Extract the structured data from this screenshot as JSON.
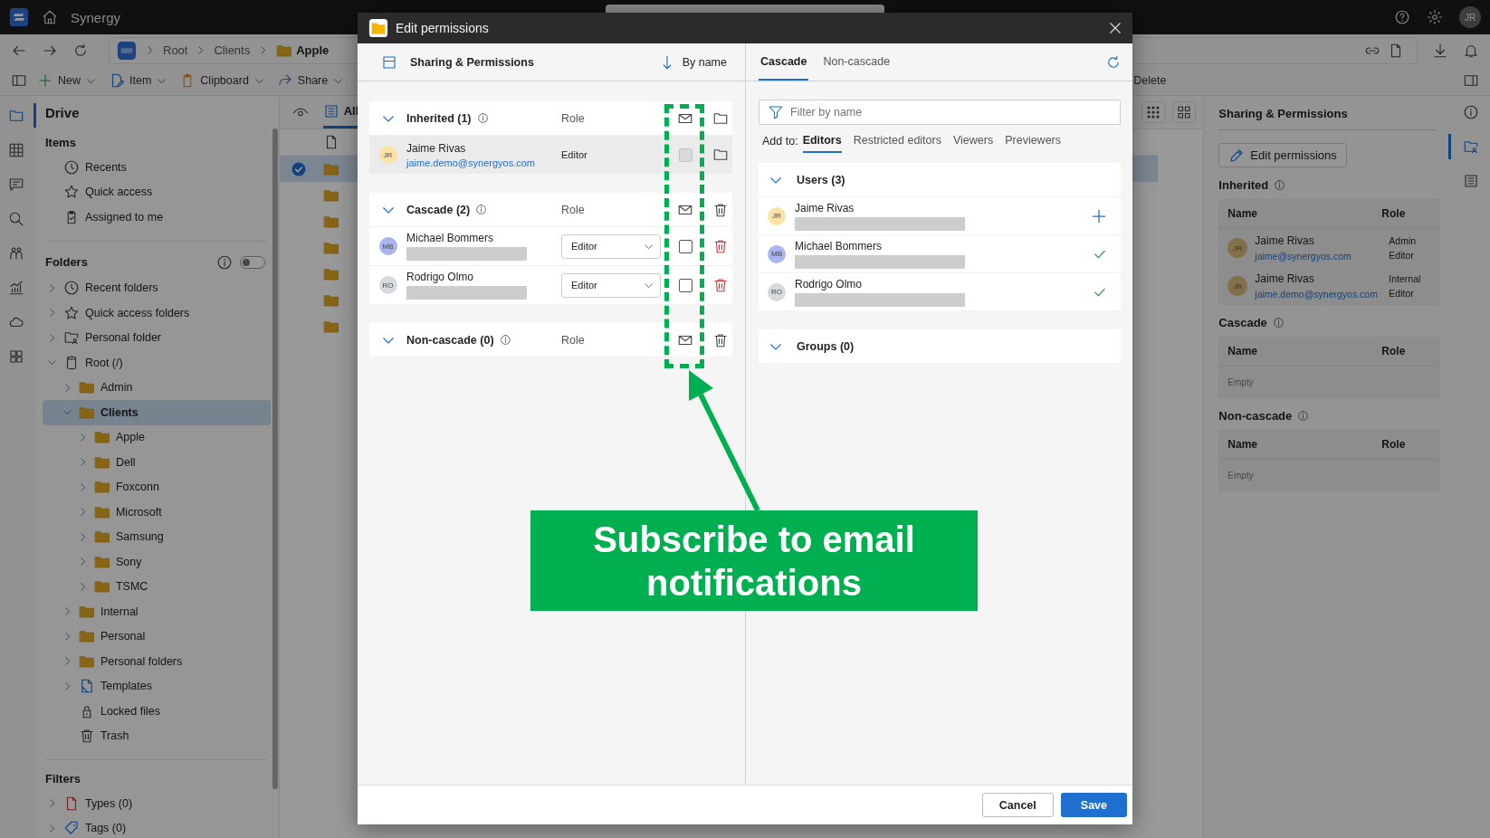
{
  "app": {
    "title": "Synergy",
    "avatar": "JR"
  },
  "breadcrumb": [
    {
      "label": "Root",
      "kind": "plain"
    },
    {
      "label": "Clients",
      "kind": "plain"
    },
    {
      "label": "Apple",
      "kind": "folder"
    }
  ],
  "toolbar": [
    {
      "label": "New",
      "kind": "new"
    },
    {
      "label": "Item",
      "kind": "item"
    },
    {
      "label": "Clipboard",
      "kind": "clipboard"
    },
    {
      "label": "Share",
      "kind": "share"
    },
    {
      "label": "Delete",
      "kind": "delete"
    }
  ],
  "rail": [
    {
      "kind": "drive",
      "selected": true
    },
    {
      "kind": "table",
      "selected": false
    },
    {
      "kind": "chat",
      "selected": false
    },
    {
      "kind": "search",
      "selected": false
    },
    {
      "kind": "people",
      "selected": false
    },
    {
      "kind": "chart",
      "selected": false
    },
    {
      "kind": "cloud",
      "selected": false
    },
    {
      "kind": "apps",
      "selected": false
    }
  ],
  "sidebar": {
    "title": "Drive",
    "items_heading": "Items",
    "items": [
      {
        "label": "Recents",
        "kind": "clock"
      },
      {
        "label": "Quick access",
        "kind": "star"
      },
      {
        "label": "Assigned to me",
        "kind": "assigned"
      }
    ],
    "folders_heading": "Folders",
    "folders_toggle_on": false,
    "folders": [
      {
        "label": "Recent folders",
        "kind": "clock",
        "expanded": false,
        "selected": false
      },
      {
        "label": "Quick access folders",
        "kind": "star",
        "expanded": false,
        "selected": false
      },
      {
        "label": "Personal folder",
        "kind": "personal",
        "expanded": false,
        "selected": false
      },
      {
        "label": "Root (/)",
        "kind": "root",
        "expanded": true,
        "selected": false,
        "children": [
          {
            "label": "Admin",
            "kind": "folder",
            "expanded": false,
            "selected": false
          },
          {
            "label": "Clients",
            "kind": "folder",
            "expanded": true,
            "selected": true,
            "children": [
              {
                "label": "Apple",
                "kind": "folder",
                "expanded": false,
                "selected": false
              },
              {
                "label": "Dell",
                "kind": "folder",
                "expanded": false,
                "selected": false
              },
              {
                "label": "Foxconn",
                "kind": "folder",
                "expanded": false,
                "selected": false
              },
              {
                "label": "Microsoft",
                "kind": "folder",
                "expanded": false,
                "selected": false
              },
              {
                "label": "Samsung",
                "kind": "folder",
                "expanded": false,
                "selected": false
              },
              {
                "label": "Sony",
                "kind": "folder",
                "expanded": false,
                "selected": false
              },
              {
                "label": "TSMC",
                "kind": "folder",
                "expanded": false,
                "selected": false
              }
            ]
          },
          {
            "label": "Internal",
            "kind": "folder",
            "expanded": false,
            "selected": false
          },
          {
            "label": "Personal",
            "kind": "folder",
            "expanded": false,
            "selected": false
          },
          {
            "label": "Personal folders",
            "kind": "folder",
            "expanded": false,
            "selected": false
          },
          {
            "label": "Templates",
            "kind": "template",
            "expanded": false,
            "selected": false
          },
          {
            "label": "Locked files",
            "kind": "lock",
            "selected": false
          },
          {
            "label": "Trash",
            "kind": "trash",
            "selected": false
          }
        ]
      }
    ],
    "filters_heading": "Filters",
    "filters": [
      {
        "label": "Types (0)",
        "kind": "types"
      },
      {
        "label": "Tags (0)",
        "kind": "tags"
      }
    ]
  },
  "list": {
    "view_tab": {
      "label": "All",
      "selected": true
    },
    "rows": [
      {
        "selected": true
      },
      {
        "selected": false
      },
      {
        "selected": false
      },
      {
        "selected": false
      },
      {
        "selected": false
      },
      {
        "selected": false
      },
      {
        "selected": false
      }
    ]
  },
  "details": {
    "title": "Sharing & Permissions",
    "edit_button": "Edit permissions",
    "sections": [
      {
        "title": "Inherited",
        "columns": [
          "Name",
          "Role"
        ],
        "rows": [
          {
            "initials": "JR",
            "name": "Jaime Rivas",
            "email": "jaime@synergyos.com",
            "role_lines": [
              "Admin",
              "Editor"
            ]
          },
          {
            "initials": "JR",
            "name": "Jaime Rivas",
            "email": "jaime.demo@synergyos.com",
            "role_lines": [
              "Internal",
              "Editor"
            ]
          }
        ]
      },
      {
        "title": "Cascade",
        "columns": [
          "Name",
          "Role"
        ],
        "empty": "Empty"
      },
      {
        "title": "Non-cascade",
        "columns": [
          "Name",
          "Role"
        ],
        "empty": "Empty"
      }
    ],
    "rail": [
      {
        "kind": "info",
        "selected": false
      },
      {
        "kind": "sharing",
        "selected": true
      },
      {
        "kind": "document",
        "selected": false
      }
    ]
  },
  "dialog": {
    "title": "Edit permissions",
    "left": {
      "title": "Sharing & Permissions",
      "sort": "By name",
      "groups": [
        {
          "title": "Inherited (1)",
          "role_heading": "Role",
          "kind": "inherited",
          "members": [
            {
              "initials": "JR",
              "color": "#fbe3a8",
              "name": "Jaime Rivas",
              "email": "jaime.demo@synergyos.com",
              "role": "Editor",
              "notify": false,
              "disabled": true
            }
          ]
        },
        {
          "title": "Cascade (2)",
          "role_heading": "Role",
          "kind": "editable",
          "members": [
            {
              "initials": "MB",
              "color": "#aab4f0",
              "name": "Michael Bommers",
              "role": "Editor",
              "notify": false,
              "disabled": false
            },
            {
              "initials": "RO",
              "color": "#d6dadd",
              "name": "Rodrigo Olmo",
              "role": "Editor",
              "notify": false,
              "disabled": false
            }
          ]
        },
        {
          "title": "Non-cascade (0)",
          "role_heading": "Role",
          "kind": "editable"
        }
      ]
    },
    "right": {
      "tabs": [
        {
          "label": "Cascade",
          "selected": true
        },
        {
          "label": "Non-cascade",
          "selected": false
        }
      ],
      "filter_placeholder": "Filter by name",
      "add_to_label": "Add to:",
      "add_to_tabs": [
        {
          "label": "Editors",
          "selected": true
        },
        {
          "label": "Restricted editors",
          "selected": false
        },
        {
          "label": "Viewers",
          "selected": false
        },
        {
          "label": "Previewers",
          "selected": false
        }
      ],
      "users_title": "Users (3)",
      "users": [
        {
          "initials": "JR",
          "color": "#fbe3a8",
          "name": "Jaime Rivas",
          "added": false
        },
        {
          "initials": "MB",
          "color": "#aab4f0",
          "name": "Michael Bommers",
          "added": true
        },
        {
          "initials": "RO",
          "color": "#d6dadd",
          "name": "Rodrigo Olmo",
          "added": true
        }
      ],
      "groups_title": "Groups (0)"
    },
    "buttons": [
      {
        "label": "Cancel",
        "kind": "secondary"
      },
      {
        "label": "Save",
        "kind": "primary"
      }
    ]
  },
  "annotation": {
    "text": "Subscribe to email notifications"
  }
}
